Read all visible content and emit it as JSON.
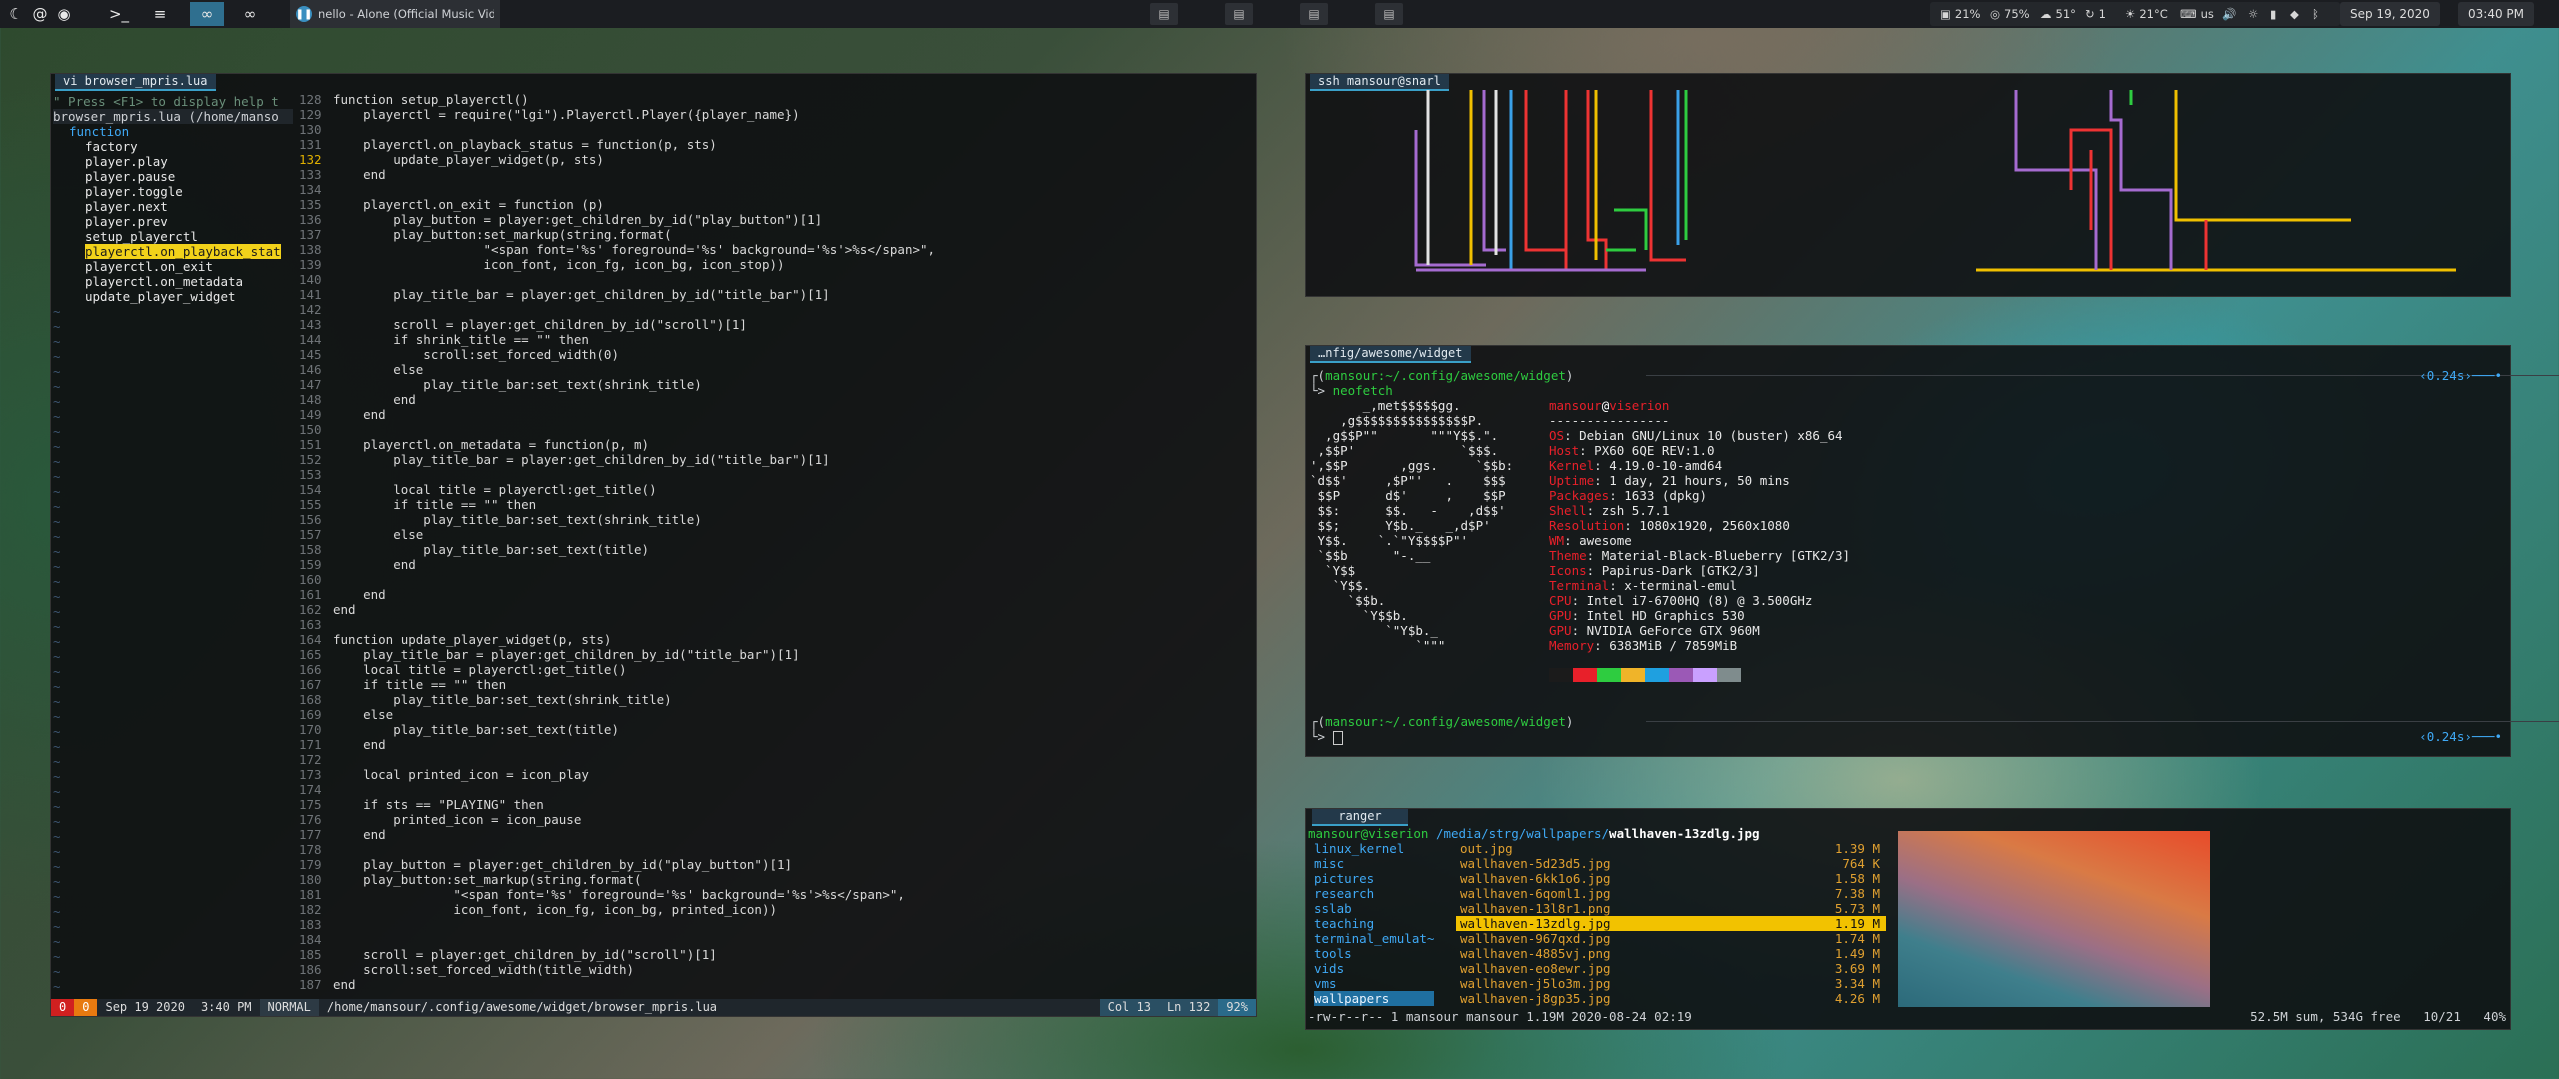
{
  "topbar": {
    "task_title": "nello - Alone (Official Music Vide",
    "stats": {
      "cpu": "21%",
      "mem": "75%",
      "temp_weather": "51°",
      "updates": "1",
      "cpu_temp": "21°C",
      "kb": "us"
    },
    "date": "Sep 19, 2020",
    "time": "03:40 PM"
  },
  "vim": {
    "tab": "vi browser_mpris.lua",
    "help_hint": "\" Press <F1> to display help t",
    "tagbar": {
      "header": "browser_mpris.lua (/home/manso",
      "group": "function",
      "items": [
        "factory",
        "player.play",
        "player.pause",
        "player.toggle",
        "player.next",
        "player.prev",
        "setup_playerctl",
        "playerctl.on_playback_stat",
        "playerctl.on_exit",
        "playerctl.on_metadata",
        "update_player_widget"
      ],
      "selected_index": 7
    },
    "status": {
      "errors": "0",
      "warnings": "0",
      "date": "Sep 19 2020",
      "time": "3:40 PM",
      "mode": "NORMAL",
      "path": "/home/mansour/.config/awesome/widget/browser_mpris.lua",
      "col": "Col 13",
      "ln": "Ln 132",
      "pct": "92%"
    },
    "code": [
      {
        "n": "128",
        "t": "function setup_playerctl()"
      },
      {
        "n": "129",
        "t": "    playerctl = require(\"lgi\").Playerctl.Player({player_name})"
      },
      {
        "n": "130",
        "t": ""
      },
      {
        "n": "131",
        "t": "    playerctl.on_playback_status = function(p, sts)"
      },
      {
        "n": "132",
        "t": "        update_player_widget(p, sts)",
        "cur": true
      },
      {
        "n": "133",
        "t": "    end"
      },
      {
        "n": "134",
        "t": ""
      },
      {
        "n": "135",
        "t": "    playerctl.on_exit = function (p)"
      },
      {
        "n": "136",
        "t": "        play_button = player:get_children_by_id(\"play_button\")[1]"
      },
      {
        "n": "137",
        "t": "        play_button:set_markup(string.format("
      },
      {
        "n": "138",
        "t": "                    \"<span font='%s' foreground='%s' background='%s'>%s</span>\","
      },
      {
        "n": "139",
        "t": "                    icon_font, icon_fg, icon_bg, icon_stop))"
      },
      {
        "n": "140",
        "t": ""
      },
      {
        "n": "141",
        "t": "        play_title_bar = player:get_children_by_id(\"title_bar\")[1]"
      },
      {
        "n": "142",
        "t": ""
      },
      {
        "n": "143",
        "t": "        scroll = player:get_children_by_id(\"scroll\")[1]"
      },
      {
        "n": "144",
        "t": "        if shrink_title == \"\" then"
      },
      {
        "n": "145",
        "t": "            scroll:set_forced_width(0)"
      },
      {
        "n": "146",
        "t": "        else"
      },
      {
        "n": "147",
        "t": "            play_title_bar:set_text(shrink_title)"
      },
      {
        "n": "148",
        "t": "        end"
      },
      {
        "n": "149",
        "t": "    end"
      },
      {
        "n": "150",
        "t": ""
      },
      {
        "n": "151",
        "t": "    playerctl.on_metadata = function(p, m)"
      },
      {
        "n": "152",
        "t": "        play_title_bar = player:get_children_by_id(\"title_bar\")[1]"
      },
      {
        "n": "153",
        "t": ""
      },
      {
        "n": "154",
        "t": "        local title = playerctl:get_title()"
      },
      {
        "n": "155",
        "t": "        if title == \"\" then"
      },
      {
        "n": "156",
        "t": "            play_title_bar:set_text(shrink_title)"
      },
      {
        "n": "157",
        "t": "        else"
      },
      {
        "n": "158",
        "t": "            play_title_bar:set_text(title)"
      },
      {
        "n": "159",
        "t": "        end"
      },
      {
        "n": "160",
        "t": ""
      },
      {
        "n": "161",
        "t": "    end"
      },
      {
        "n": "162",
        "t": "end"
      },
      {
        "n": "163",
        "t": ""
      },
      {
        "n": "164",
        "t": "function update_player_widget(p, sts)"
      },
      {
        "n": "165",
        "t": "    play_title_bar = player:get_children_by_id(\"title_bar\")[1]"
      },
      {
        "n": "166",
        "t": "    local title = playerctl:get_title()"
      },
      {
        "n": "167",
        "t": "    if title == \"\" then"
      },
      {
        "n": "168",
        "t": "        play_title_bar:set_text(shrink_title)"
      },
      {
        "n": "169",
        "t": "    else"
      },
      {
        "n": "170",
        "t": "        play_title_bar:set_text(title)"
      },
      {
        "n": "171",
        "t": "    end"
      },
      {
        "n": "172",
        "t": ""
      },
      {
        "n": "173",
        "t": "    local printed_icon = icon_play"
      },
      {
        "n": "174",
        "t": ""
      },
      {
        "n": "175",
        "t": "    if sts == \"PLAYING\" then"
      },
      {
        "n": "176",
        "t": "        printed_icon = icon_pause"
      },
      {
        "n": "177",
        "t": "    end"
      },
      {
        "n": "178",
        "t": ""
      },
      {
        "n": "179",
        "t": "    play_button = player:get_children_by_id(\"play_button\")[1]"
      },
      {
        "n": "180",
        "t": "    play_button:set_markup(string.format("
      },
      {
        "n": "181",
        "t": "                \"<span font='%s' foreground='%s' background='%s'>%s</span>\","
      },
      {
        "n": "182",
        "t": "                icon_font, icon_fg, icon_bg, printed_icon))"
      },
      {
        "n": "183",
        "t": ""
      },
      {
        "n": "184",
        "t": ""
      },
      {
        "n": "185",
        "t": "    scroll = player:get_children_by_id(\"scroll\")[1]"
      },
      {
        "n": "186",
        "t": "    scroll:set_forced_width(title_width)"
      },
      {
        "n": "187",
        "t": "end"
      }
    ]
  },
  "snarl": {
    "tab": "ssh mansour@snarl"
  },
  "neofetch": {
    "tab": "…nfig/awesome/widget",
    "prompt1": "mansour:~/.config/awesome/widget",
    "cmd": "neofetch",
    "elapsed1": "0.24s",
    "user": "mansour",
    "host": "viserion",
    "sep": "----------------",
    "info": [
      {
        "k": "OS",
        "v": "Debian GNU/Linux 10 (buster) x86_64"
      },
      {
        "k": "Host",
        "v": "PX60 6QE REV:1.0"
      },
      {
        "k": "Kernel",
        "v": "4.19.0-10-amd64"
      },
      {
        "k": "Uptime",
        "v": "1 day, 21 hours, 50 mins"
      },
      {
        "k": "Packages",
        "v": "1633 (dpkg)"
      },
      {
        "k": "Shell",
        "v": "zsh 5.7.1"
      },
      {
        "k": "Resolution",
        "v": "1080x1920, 2560x1080"
      },
      {
        "k": "WM",
        "v": "awesome"
      },
      {
        "k": "Theme",
        "v": "Material-Black-Blueberry [GTK2/3]"
      },
      {
        "k": "Icons",
        "v": "Papirus-Dark [GTK2/3]"
      },
      {
        "k": "Terminal",
        "v": "x-terminal-emul"
      },
      {
        "k": "CPU",
        "v": "Intel i7-6700HQ (8) @ 3.500GHz"
      },
      {
        "k": "GPU",
        "v": "Intel HD Graphics 530"
      },
      {
        "k": "GPU",
        "v": "NVIDIA GeForce GTX 960M"
      },
      {
        "k": "Memory",
        "v": "6383MiB / 7859MiB"
      }
    ],
    "palette": [
      "#1b1b1b",
      "#e8202a",
      "#2ecc40",
      "#f0b429",
      "#1fa0e0",
      "#9b59b6",
      "#c9a0ff",
      "#7f8c8d"
    ],
    "prompt2": "mansour:~/.config/awesome/widget",
    "elapsed2": "0.24s",
    "ascii": [
      "       _,met$$$$$gg.",
      "    ,g$$$$$$$$$$$$$$$P.",
      "  ,g$$P\"\"       \"\"\"Y$$.\".",
      " ,$$P'              `$$$.",
      "',$$P       ,ggs.     `$$b:",
      "`d$$'     ,$P\"'   .    $$$",
      " $$P      d$'     ,    $$P",
      " $$:      $$.   -    ,d$$'",
      " $$;      Y$b._   _,d$P'",
      " Y$$.    `.`\"Y$$$$P\"'",
      " `$$b      \"-.__",
      "  `Y$$",
      "   `Y$$.",
      "     `$$b.",
      "       `Y$$b.",
      "          `\"Y$b._",
      "              `\"\"\""
    ]
  },
  "ranger": {
    "tab": "ranger",
    "header_user": "mansour@viserion",
    "header_path": "/media/strg/wallpapers/",
    "header_file": "wallhaven-13zdlg.jpg",
    "dirs": [
      "linux_kernel",
      "misc",
      "pictures",
      "research",
      "sslab",
      "teaching",
      "terminal_emulat~",
      "tools",
      "vids",
      "vms",
      "wallpapers"
    ],
    "files": [
      {
        "name": "out.jpg",
        "size": "1.39 M"
      },
      {
        "name": "wallhaven-5d23d5.jpg",
        "size": "764 K"
      },
      {
        "name": "wallhaven-6kk1o6.jpg",
        "size": "1.58 M"
      },
      {
        "name": "wallhaven-6qoml1.jpg",
        "size": "7.38 M"
      },
      {
        "name": "wallhaven-13l8r1.png",
        "size": "5.73 M"
      },
      {
        "name": "wallhaven-13zdlg.jpg",
        "size": "1.19 M"
      },
      {
        "name": "wallhaven-967qxd.jpg",
        "size": "1.74 M"
      },
      {
        "name": "wallhaven-4885vj.png",
        "size": "1.49 M"
      },
      {
        "name": "wallhaven-eo8ewr.jpg",
        "size": "3.69 M"
      },
      {
        "name": "wallhaven-j5lo3m.jpg",
        "size": "3.34 M"
      },
      {
        "name": "wallhaven-j8gp35.jpg",
        "size": "4.26 M"
      }
    ],
    "selected_index": 5,
    "footer_left": "-rw-r--r-- 1 mansour mansour 1.19M 2020-08-24 02:19",
    "footer_right": "52.5M sum, 534G free   10/21   40%"
  }
}
